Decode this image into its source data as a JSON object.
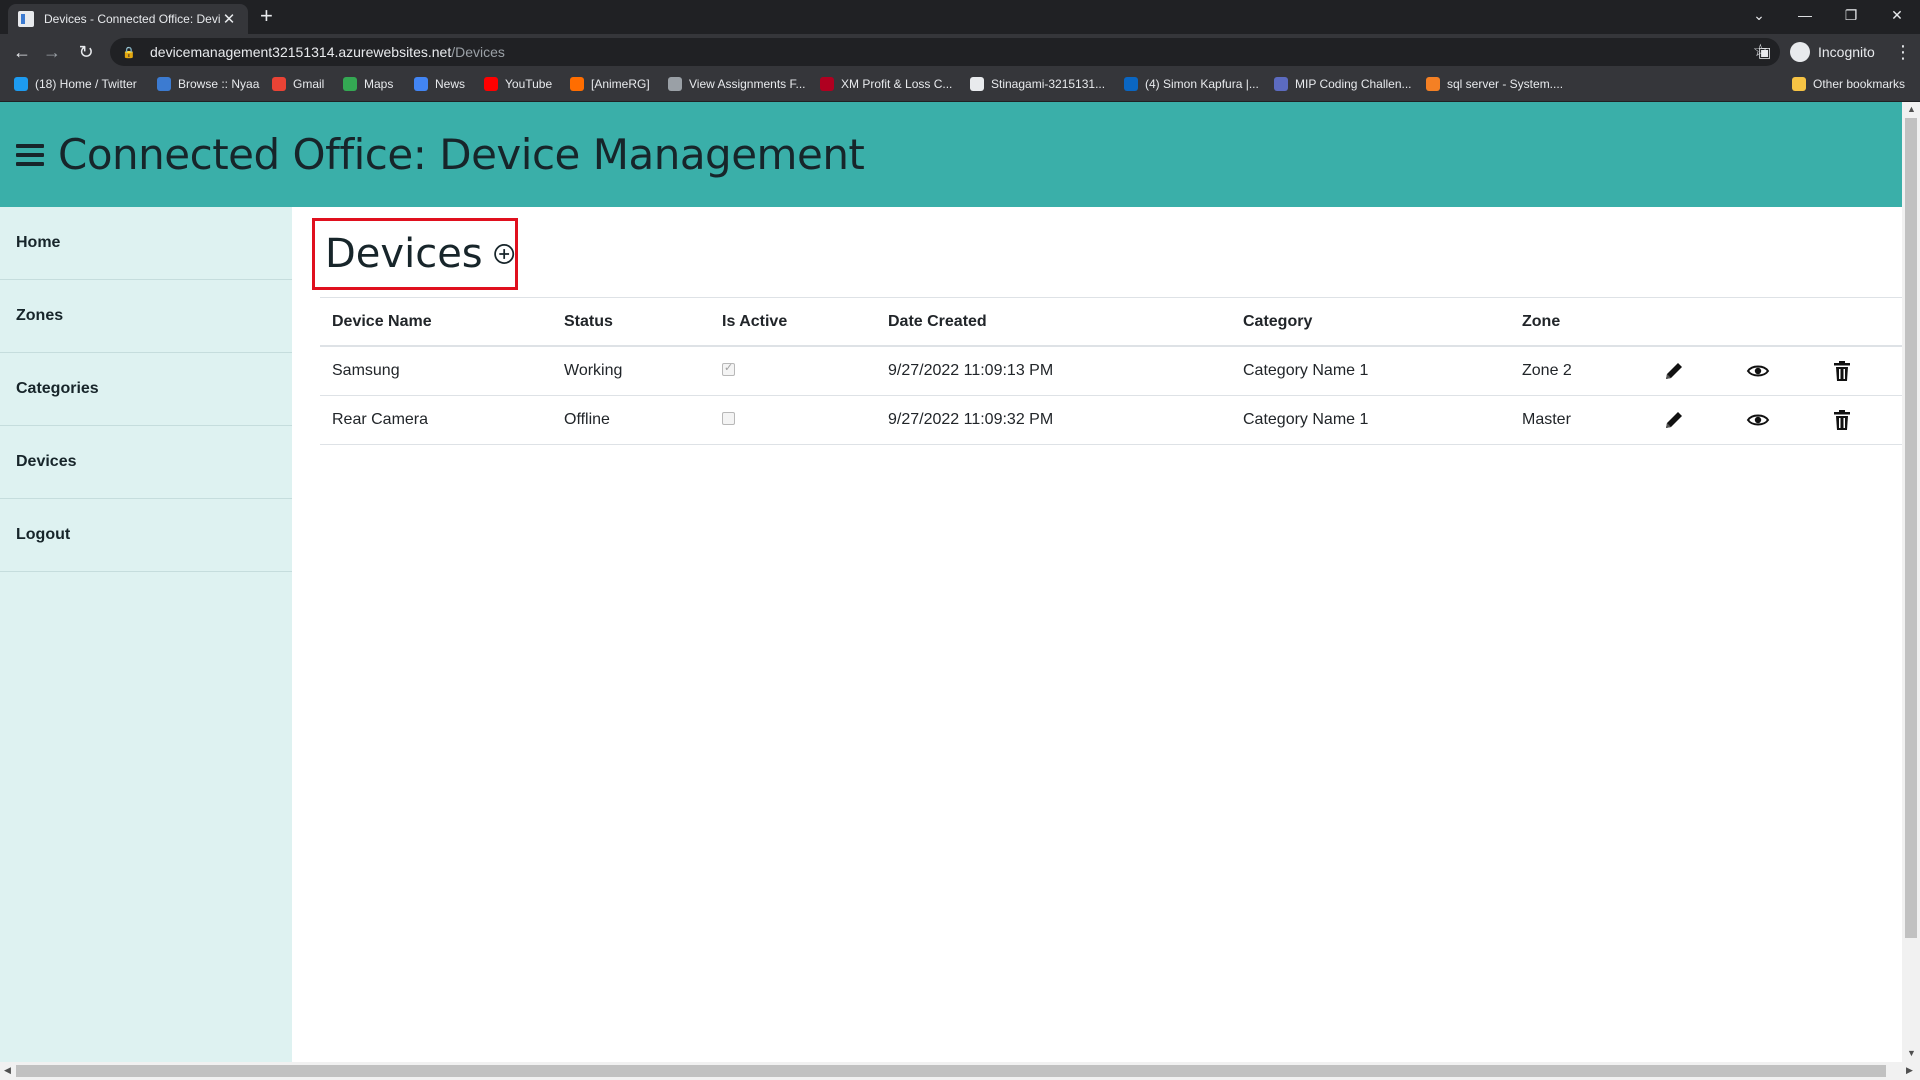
{
  "browser": {
    "tab_title": "Devices - Connected Office: Devi",
    "url_host": "devicemanagement32151314.azurewebsites.net",
    "url_path": "/Devices",
    "profile_label": "Incognito",
    "bookmarks": [
      {
        "label": "(18) Home / Twitter",
        "color": "#1d9bf0"
      },
      {
        "label": "Browse :: Nyaa",
        "color": "#3c7bd1"
      },
      {
        "label": "Gmail",
        "color": "#ea4335"
      },
      {
        "label": "Maps",
        "color": "#34a853"
      },
      {
        "label": "News",
        "color": "#4285f4"
      },
      {
        "label": "YouTube",
        "color": "#ff0000"
      },
      {
        "label": "[AnimeRG]",
        "color": "#ff6d00"
      },
      {
        "label": "View Assignments F...",
        "color": "#9aa0a6"
      },
      {
        "label": "XM Profit & Loss C...",
        "color": "#b00020"
      },
      {
        "label": "Stinagami-3215131...",
        "color": "#e8eaed"
      },
      {
        "label": "(4) Simon Kapfura |...",
        "color": "#0a66c2"
      },
      {
        "label": "MIP Coding Challen...",
        "color": "#5c6bc0"
      },
      {
        "label": "sql server - System....",
        "color": "#f48024"
      }
    ],
    "other_bookmarks": "Other bookmarks"
  },
  "app": {
    "title": "Connected Office: Device Management"
  },
  "sidebar": {
    "items": [
      {
        "label": "Home"
      },
      {
        "label": "Zones"
      },
      {
        "label": "Categories"
      },
      {
        "label": "Devices"
      },
      {
        "label": "Logout"
      }
    ]
  },
  "page": {
    "heading": "Devices"
  },
  "table": {
    "columns": [
      "Device Name",
      "Status",
      "Is Active",
      "Date Created",
      "Category",
      "Zone"
    ],
    "rows": [
      {
        "name": "Samsung",
        "status": "Working",
        "active": true,
        "created": "9/27/2022 11:09:13 PM",
        "category": "Category Name 1",
        "zone": "Zone 2"
      },
      {
        "name": "Rear Camera",
        "status": "Offline",
        "active": false,
        "created": "9/27/2022 11:09:32 PM",
        "category": "Category Name 1",
        "zone": "Master"
      }
    ]
  },
  "colors": {
    "header": "#3aafa9",
    "sidebar": "#def2f1",
    "highlight_border": "#e0101e",
    "text_dark": "#17252a"
  }
}
